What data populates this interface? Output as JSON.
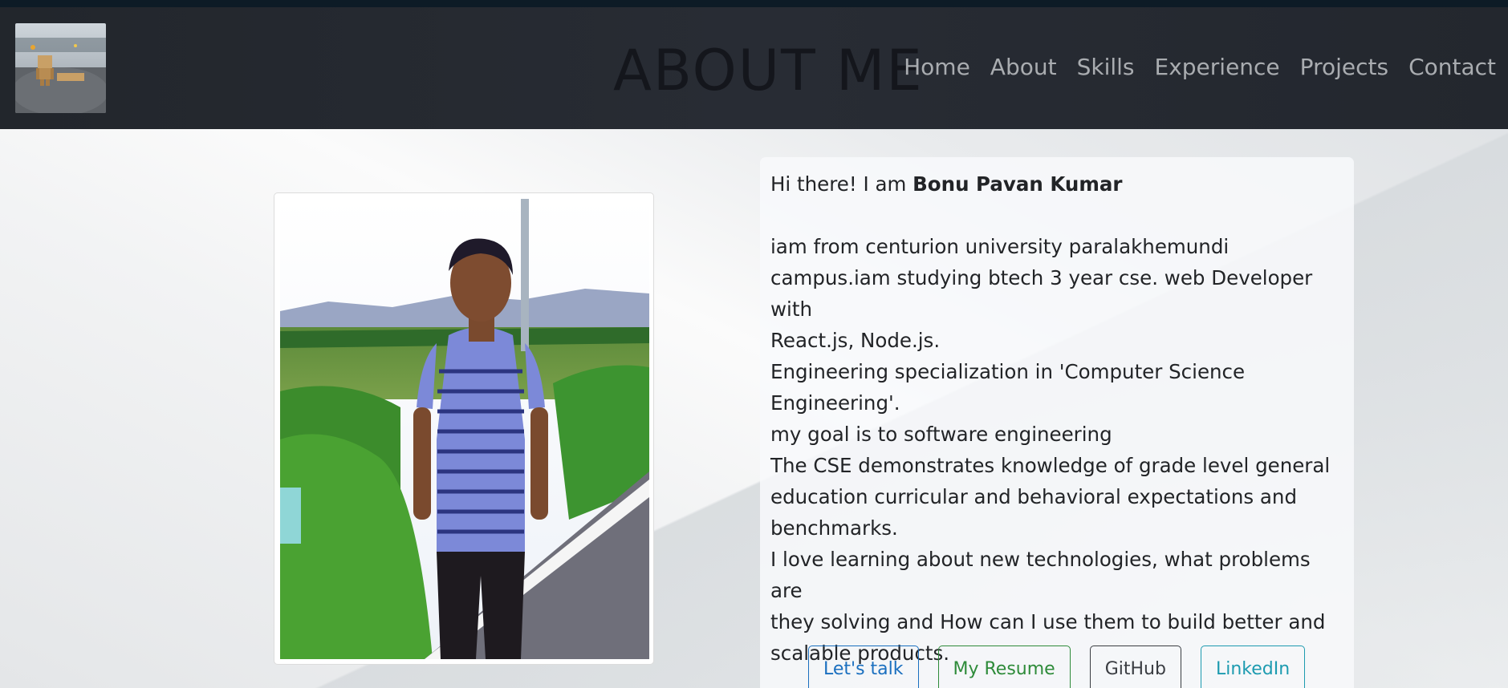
{
  "nav": {
    "title": "ABOUT ME",
    "links": [
      "Home",
      "About",
      "Skills",
      "Experience",
      "Projects",
      "Contact"
    ]
  },
  "about": {
    "greeting_prefix": "Hi there! I am ",
    "name": "Bonu Pavan Kumar",
    "lines": [
      "iam from centurion university paralakhemundi",
      "campus.iam studying btech 3 year cse. web Developer with",
      "React.js, Node.js.",
      "Engineering specialization in 'Computer Science",
      "Engineering'.",
      "my goal is to software engineering",
      "The CSE demonstrates knowledge of grade level general",
      "education curricular and behavioral expectations and",
      "benchmarks.",
      "I love learning about new technologies, what problems are",
      "they solving and How can I use them to build better and",
      "scalable products."
    ]
  },
  "buttons": {
    "talk": "Let's talk",
    "resume": "My Resume",
    "github": "GitHub",
    "linkedin": "LinkedIn"
  },
  "colors": {
    "navbar": "#282c34",
    "talk": "#1a6fbf",
    "resume": "#2e8b3a",
    "github": "#3a3d42",
    "linkedin": "#1d9bb0"
  }
}
